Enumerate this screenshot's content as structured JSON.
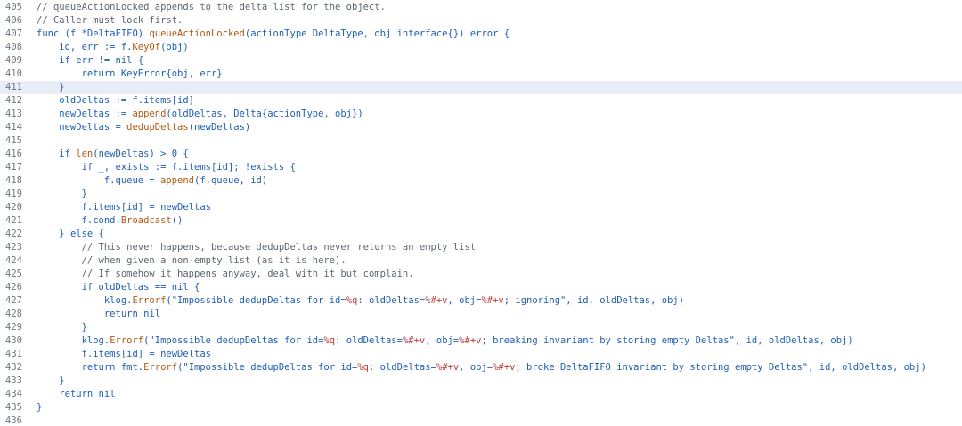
{
  "code_view": {
    "highlighted_line": 411,
    "lines": [
      {
        "number": "405",
        "tokens": [
          {
            "t": "c",
            "v": "// queueActionLocked appends to the delta list for the object."
          }
        ]
      },
      {
        "number": "406",
        "tokens": [
          {
            "t": "c",
            "v": "// Caller must lock first."
          }
        ]
      },
      {
        "number": "407",
        "tokens": [
          {
            "t": "k",
            "v": "func"
          },
          {
            "t": "p",
            "v": " (f *DeltaFIFO) "
          },
          {
            "t": "f",
            "v": "queueActionLocked"
          },
          {
            "t": "p",
            "v": "(actionType DeltaType, obj "
          },
          {
            "t": "k",
            "v": "interface"
          },
          {
            "t": "p",
            "v": "{}) "
          },
          {
            "t": "k",
            "v": "error"
          },
          {
            "t": "p",
            "v": " {"
          }
        ]
      },
      {
        "number": "408",
        "tokens": [
          {
            "t": "p",
            "v": "    id, err := f."
          },
          {
            "t": "f",
            "v": "KeyOf"
          },
          {
            "t": "p",
            "v": "(obj)"
          }
        ]
      },
      {
        "number": "409",
        "tokens": [
          {
            "t": "p",
            "v": "    "
          },
          {
            "t": "k",
            "v": "if"
          },
          {
            "t": "p",
            "v": " err != "
          },
          {
            "t": "k",
            "v": "nil"
          },
          {
            "t": "p",
            "v": " {"
          }
        ]
      },
      {
        "number": "410",
        "tokens": [
          {
            "t": "p",
            "v": "        "
          },
          {
            "t": "k",
            "v": "return"
          },
          {
            "t": "p",
            "v": " KeyError{obj, err}"
          }
        ]
      },
      {
        "number": "411",
        "tokens": [
          {
            "t": "p",
            "v": "    }"
          }
        ]
      },
      {
        "number": "412",
        "tokens": [
          {
            "t": "p",
            "v": "    oldDeltas := f.items[id]"
          }
        ]
      },
      {
        "number": "413",
        "tokens": [
          {
            "t": "p",
            "v": "    newDeltas := "
          },
          {
            "t": "f",
            "v": "append"
          },
          {
            "t": "p",
            "v": "(oldDeltas, Delta{actionType, obj})"
          }
        ]
      },
      {
        "number": "414",
        "tokens": [
          {
            "t": "p",
            "v": "    newDeltas = "
          },
          {
            "t": "f",
            "v": "dedupDeltas"
          },
          {
            "t": "p",
            "v": "(newDeltas)"
          }
        ]
      },
      {
        "number": "415",
        "tokens": []
      },
      {
        "number": "416",
        "tokens": [
          {
            "t": "p",
            "v": "    "
          },
          {
            "t": "k",
            "v": "if"
          },
          {
            "t": "p",
            "v": " "
          },
          {
            "t": "f",
            "v": "len"
          },
          {
            "t": "p",
            "v": "(newDeltas) > 0 {"
          }
        ]
      },
      {
        "number": "417",
        "tokens": [
          {
            "t": "p",
            "v": "        "
          },
          {
            "t": "k",
            "v": "if"
          },
          {
            "t": "p",
            "v": " _, exists := f.items[id]; !exists {"
          }
        ]
      },
      {
        "number": "418",
        "tokens": [
          {
            "t": "p",
            "v": "            f.queue = "
          },
          {
            "t": "f",
            "v": "append"
          },
          {
            "t": "p",
            "v": "(f.queue, id)"
          }
        ]
      },
      {
        "number": "419",
        "tokens": [
          {
            "t": "p",
            "v": "        }"
          }
        ]
      },
      {
        "number": "420",
        "tokens": [
          {
            "t": "p",
            "v": "        f.items[id] = newDeltas"
          }
        ]
      },
      {
        "number": "421",
        "tokens": [
          {
            "t": "p",
            "v": "        f.cond."
          },
          {
            "t": "f",
            "v": "Broadcast"
          },
          {
            "t": "p",
            "v": "()"
          }
        ]
      },
      {
        "number": "422",
        "tokens": [
          {
            "t": "p",
            "v": "    } "
          },
          {
            "t": "k",
            "v": "else"
          },
          {
            "t": "p",
            "v": " {"
          }
        ]
      },
      {
        "number": "423",
        "tokens": [
          {
            "t": "p",
            "v": "        "
          },
          {
            "t": "c",
            "v": "// This never happens, because dedupDeltas never returns an empty list"
          }
        ]
      },
      {
        "number": "424",
        "tokens": [
          {
            "t": "p",
            "v": "        "
          },
          {
            "t": "c",
            "v": "// when given a non-empty list (as it is here)."
          }
        ]
      },
      {
        "number": "425",
        "tokens": [
          {
            "t": "p",
            "v": "        "
          },
          {
            "t": "c",
            "v": "// If somehow it happens anyway, deal with it but complain."
          }
        ]
      },
      {
        "number": "426",
        "tokens": [
          {
            "t": "p",
            "v": "        "
          },
          {
            "t": "k",
            "v": "if"
          },
          {
            "t": "p",
            "v": " oldDeltas == "
          },
          {
            "t": "k",
            "v": "nil"
          },
          {
            "t": "p",
            "v": " {"
          }
        ]
      },
      {
        "number": "427",
        "tokens": [
          {
            "t": "p",
            "v": "            klog."
          },
          {
            "t": "f",
            "v": "Errorf"
          },
          {
            "t": "s",
            "v": "(\"Impossible dedupDeltas for id="
          },
          {
            "t": "e",
            "v": "%q"
          },
          {
            "t": "s",
            "v": ": oldDeltas="
          },
          {
            "t": "e",
            "v": "%#+v"
          },
          {
            "t": "s",
            "v": ", obj="
          },
          {
            "t": "e",
            "v": "%#+v"
          },
          {
            "t": "s",
            "v": "; ignoring\""
          },
          {
            "t": "p",
            "v": ", id, oldDeltas, obj)"
          }
        ]
      },
      {
        "number": "428",
        "tokens": [
          {
            "t": "p",
            "v": "            "
          },
          {
            "t": "k",
            "v": "return"
          },
          {
            "t": "p",
            "v": " "
          },
          {
            "t": "k",
            "v": "nil"
          }
        ]
      },
      {
        "number": "429",
        "tokens": [
          {
            "t": "p",
            "v": "        }"
          }
        ]
      },
      {
        "number": "430",
        "tokens": [
          {
            "t": "p",
            "v": "        klog."
          },
          {
            "t": "f",
            "v": "Errorf"
          },
          {
            "t": "s",
            "v": "(\"Impossible dedupDeltas for id="
          },
          {
            "t": "e",
            "v": "%q"
          },
          {
            "t": "s",
            "v": ": oldDeltas="
          },
          {
            "t": "e",
            "v": "%#+v"
          },
          {
            "t": "s",
            "v": ", obj="
          },
          {
            "t": "e",
            "v": "%#+v"
          },
          {
            "t": "s",
            "v": "; breaking invariant by storing empty Deltas\""
          },
          {
            "t": "p",
            "v": ", id, oldDeltas, obj)"
          }
        ]
      },
      {
        "number": "431",
        "tokens": [
          {
            "t": "p",
            "v": "        f.items[id] = newDeltas"
          }
        ]
      },
      {
        "number": "432",
        "tokens": [
          {
            "t": "p",
            "v": "        "
          },
          {
            "t": "k",
            "v": "return"
          },
          {
            "t": "p",
            "v": " fmt."
          },
          {
            "t": "f",
            "v": "Errorf"
          },
          {
            "t": "s",
            "v": "(\"Impossible dedupDeltas for id="
          },
          {
            "t": "e",
            "v": "%q"
          },
          {
            "t": "s",
            "v": ": oldDeltas="
          },
          {
            "t": "e",
            "v": "%#+v"
          },
          {
            "t": "s",
            "v": ", obj="
          },
          {
            "t": "e",
            "v": "%#+v"
          },
          {
            "t": "s",
            "v": "; broke DeltaFIFO invariant by storing empty Deltas\""
          },
          {
            "t": "p",
            "v": ", id, oldDeltas, obj)"
          }
        ]
      },
      {
        "number": "433",
        "tokens": [
          {
            "t": "p",
            "v": "    }"
          }
        ]
      },
      {
        "number": "434",
        "tokens": [
          {
            "t": "p",
            "v": "    "
          },
          {
            "t": "k",
            "v": "return"
          },
          {
            "t": "p",
            "v": " "
          },
          {
            "t": "k",
            "v": "nil"
          }
        ]
      },
      {
        "number": "435",
        "tokens": [
          {
            "t": "p",
            "v": "}"
          }
        ]
      },
      {
        "number": "436",
        "tokens": []
      }
    ]
  }
}
